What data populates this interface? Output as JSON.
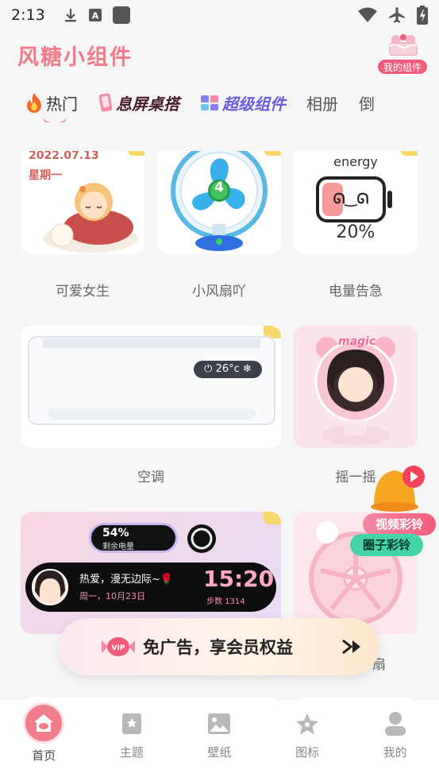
{
  "status": {
    "time": "2:13"
  },
  "app": {
    "title": "风糖小组件",
    "my_widgets": "我的组件"
  },
  "tabs": [
    {
      "label": "热门",
      "active": true
    },
    {
      "label": "息屏桌搭"
    },
    {
      "label": "超级组件"
    },
    {
      "label": "相册"
    },
    {
      "label": "倒"
    }
  ],
  "widgets": {
    "cute_girl": {
      "date": "2022.07.13",
      "weekday": "星期一",
      "label": "可爱女生"
    },
    "fan": {
      "speed": "4",
      "label": "小风扇吖"
    },
    "battery": {
      "title": "energy",
      "face": "ᘏ‿ᘏ",
      "percent": "20%",
      "label": "电量告急"
    },
    "aircon": {
      "temp": "26°c",
      "label": "空调"
    },
    "shake": {
      "frame_text": "magic",
      "label": "摇一摇"
    },
    "music": {
      "battery_pct": "54%",
      "battery_sub": "剩余电量",
      "song": "热爱，漫无边际~🌹",
      "date": "周一，10月23日",
      "time": "15:20",
      "steps": "步数 1314"
    },
    "fan2": {
      "label": "扇"
    }
  },
  "promo": {
    "vip_badge": "VIP",
    "text": "免广告，享会员权益"
  },
  "float_ad": {
    "video_ring": "视频彩铃",
    "circle_ring": "圈子彩铃"
  },
  "nav": [
    {
      "label": "首页",
      "icon": "home-icon",
      "active": true
    },
    {
      "label": "主题",
      "icon": "bookmark-icon"
    },
    {
      "label": "壁纸",
      "icon": "image-icon"
    },
    {
      "label": "图标",
      "icon": "star-icon"
    },
    {
      "label": "我的",
      "icon": "user-icon"
    }
  ],
  "colors": {
    "brand": "#f07c8c",
    "vip": "#f25c7c",
    "fan_blue": "#2f6fe0"
  }
}
